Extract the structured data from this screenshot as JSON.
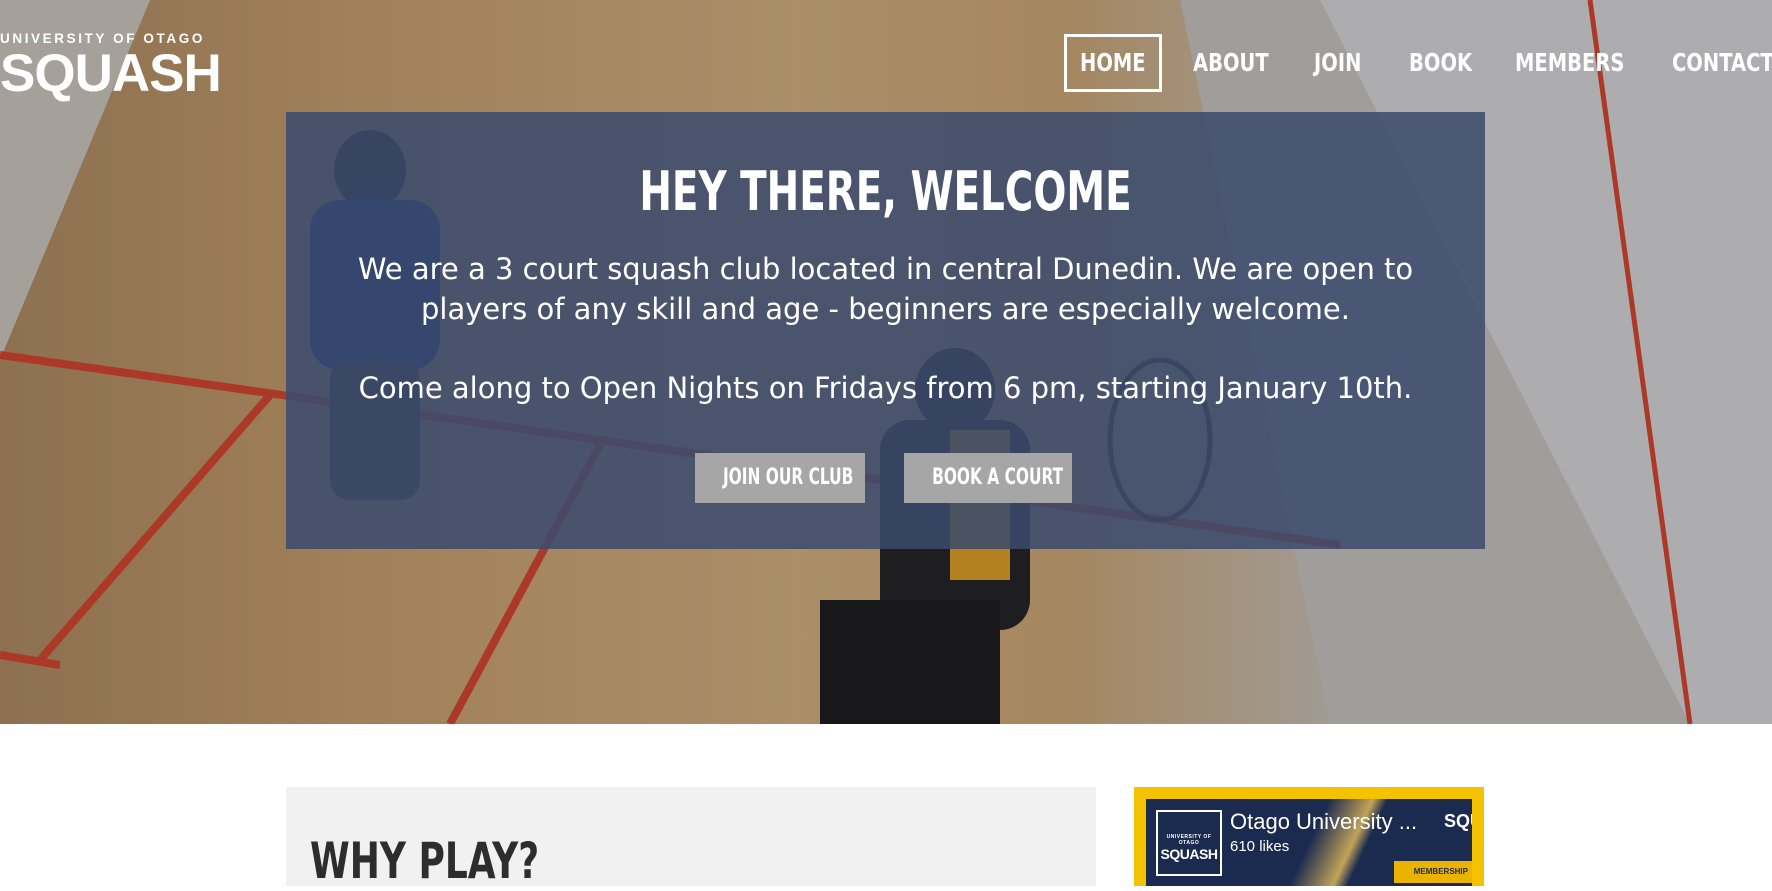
{
  "logo": {
    "top_line": "UNIVERSITY OF OTAGO",
    "main": "SQUASH"
  },
  "nav": {
    "items": [
      {
        "label": "HOME",
        "active": true
      },
      {
        "label": "ABOUT"
      },
      {
        "label": "JOIN"
      },
      {
        "label": "BOOK"
      },
      {
        "label": "MEMBERS"
      },
      {
        "label": "CONTACT"
      }
    ]
  },
  "hero": {
    "heading": "HEY THERE, WELCOME",
    "paragraph_1": "We are a 3 court squash club located in central Dunedin. We are open to players of any skill and age - beginners are especially welcome.",
    "paragraph_2": "Come along to Open Nights on Fridays from 6 pm, starting January 10th.",
    "buttons": {
      "join": "JOIN OUR CLUB",
      "book": "BOOK A COURT"
    }
  },
  "why": {
    "heading": "WHY PLAY?"
  },
  "facebook": {
    "page_name": "Otago University ...",
    "likes": "610 likes",
    "avatar_top": "UNIVERSITY OF OTAGO",
    "avatar_main": "SQUASH",
    "side_text": "SQU",
    "tag": "MEMBERSHIP",
    "accent": "#f5c200"
  },
  "colors": {
    "panel": "#3a4a6e",
    "button": "#a6a6a6"
  }
}
